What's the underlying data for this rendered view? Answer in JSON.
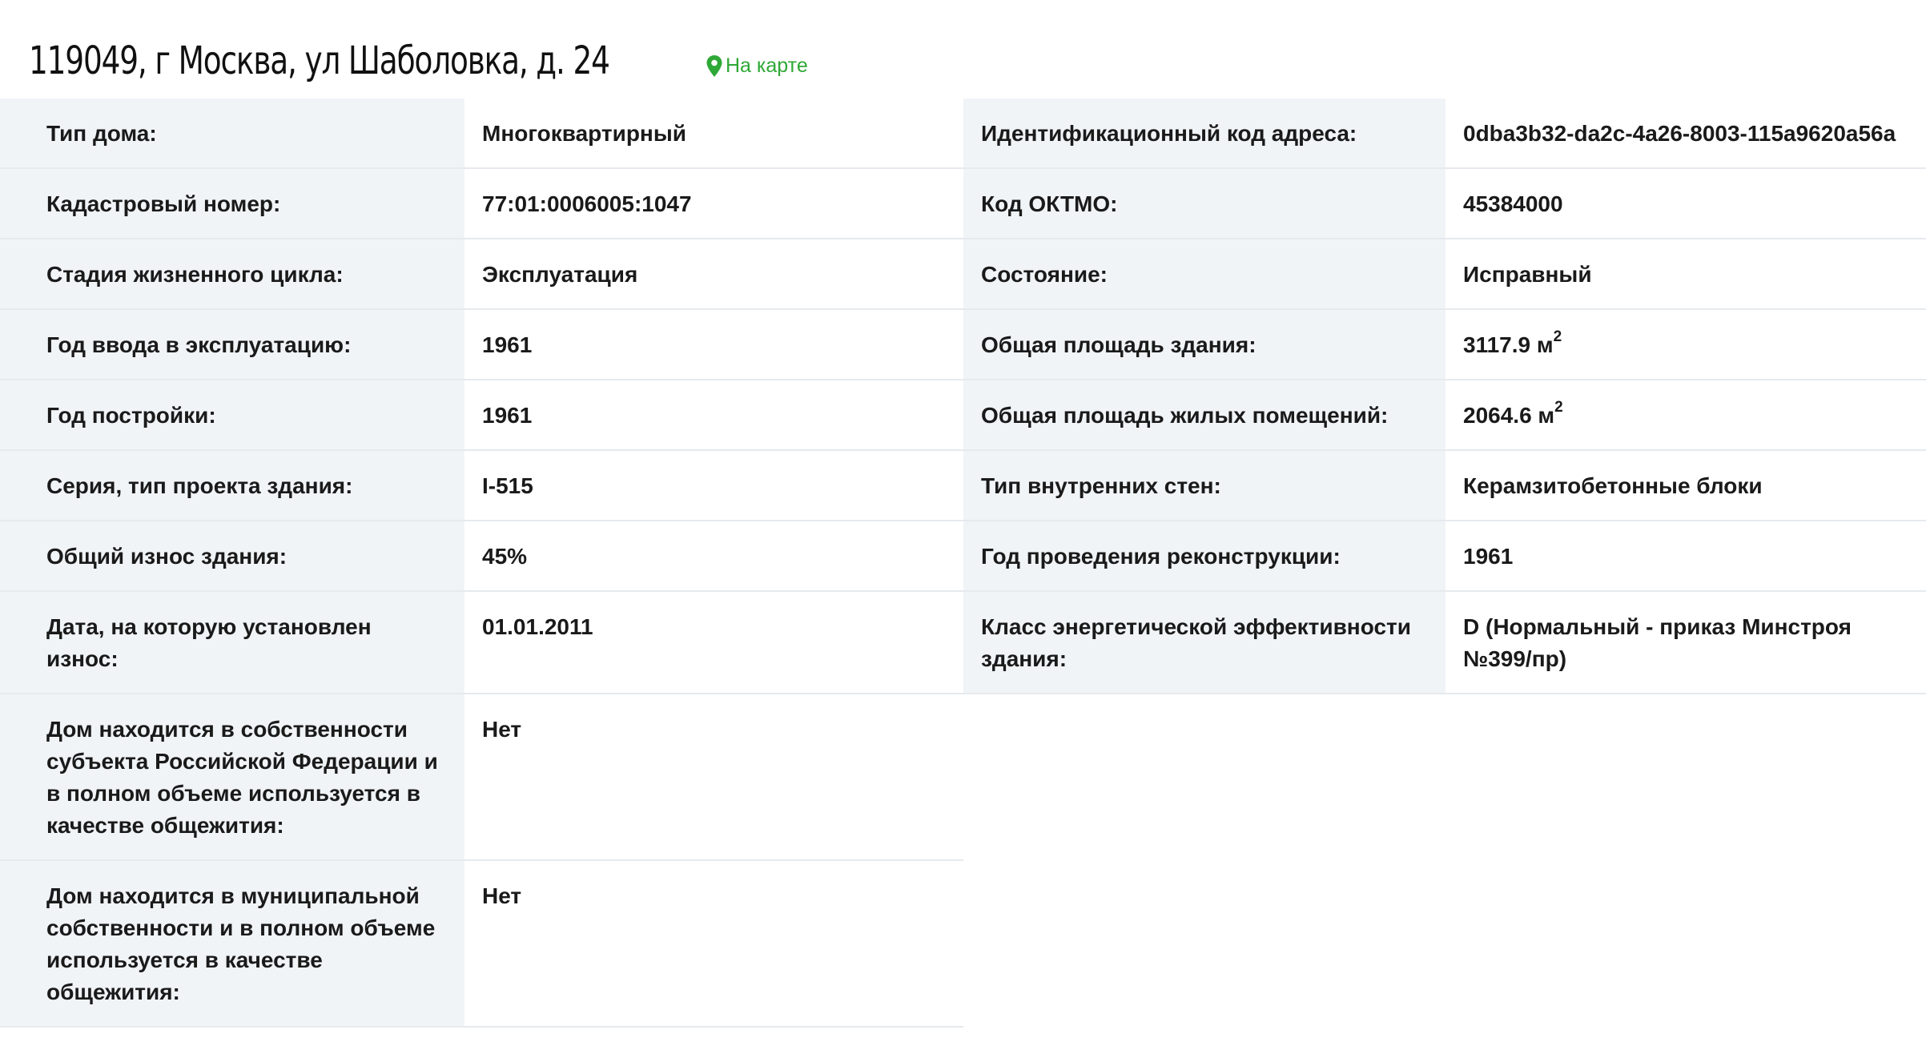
{
  "header": {
    "address": "119049, г Москва, ул Шаболовка, д. 24",
    "map_link": "На карте"
  },
  "colors": {
    "accent_green": "#2ea836",
    "label_bg": "#f0f4f7",
    "border": "#e6eaee"
  },
  "left_table": [
    {
      "label": "Тип дома:",
      "value": "Многоквартирный"
    },
    {
      "label": "Кадастровый номер:",
      "value": "77:01:0006005:1047"
    },
    {
      "label": "Стадия жизненного цикла:",
      "value": "Эксплуатация"
    },
    {
      "label": "Год ввода в эксплуатацию:",
      "value": "1961"
    },
    {
      "label": "Год постройки:",
      "value": "1961"
    },
    {
      "label": "Серия, тип проекта здания:",
      "value": "I-515"
    },
    {
      "label": "Общий износ здания:",
      "value": "45%"
    },
    {
      "label": "Дата, на которую установлен износ:",
      "value": "01.01.2011"
    },
    {
      "label": "Дом находится в собственности субъекта Российской Федерации и в полном объеме используется в качестве общежития:",
      "value": "Нет"
    },
    {
      "label": "Дом находится в муниципальной собственности и в полном объеме используется в качестве общежития:",
      "value": "Нет"
    }
  ],
  "right_table": [
    {
      "label": "Идентификационный код адреса:",
      "value": "0dba3b32-da2c-4a26-8003-115a9620a56a"
    },
    {
      "label": "Код ОКТМО:",
      "value": "45384000"
    },
    {
      "label": "Состояние:",
      "value": "Исправный"
    },
    {
      "label": "Общая площадь здания:",
      "value": "3117.9 м",
      "unit_sup": "2"
    },
    {
      "label": "Общая площадь жилых помещений:",
      "value": "2064.6 м",
      "unit_sup": "2"
    },
    {
      "label": "Тип внутренних стен:",
      "value": "Керамзитобетонные блоки"
    },
    {
      "label": "Год проведения реконструкции:",
      "value": "1961"
    },
    {
      "label": "Класс энергетической эффективности здания:",
      "value": "D (Нормальный - приказ Минстроя №399/пр)"
    }
  ]
}
